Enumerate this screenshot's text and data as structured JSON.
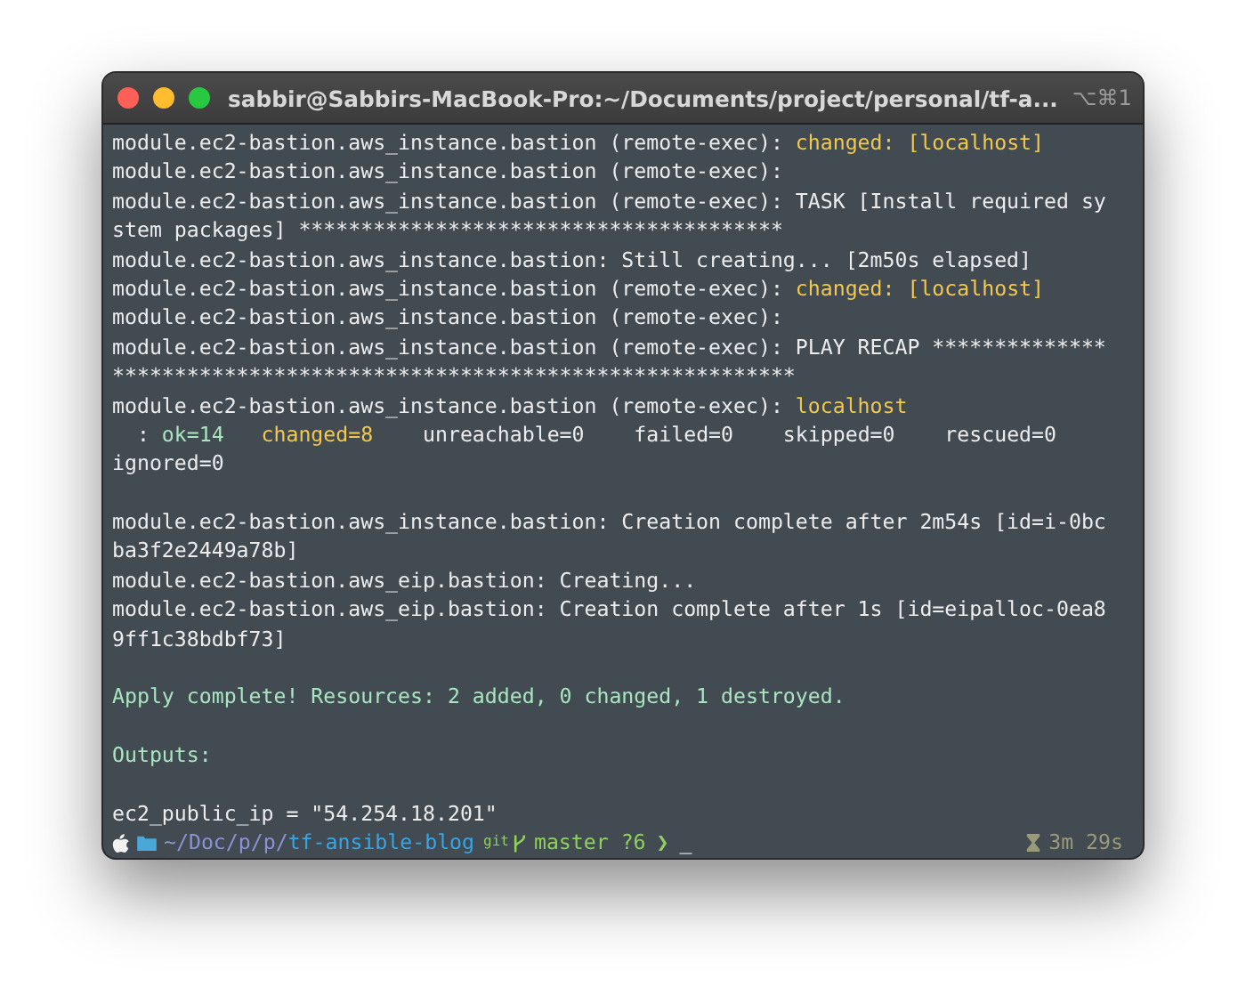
{
  "window": {
    "title": "sabbir@Sabbirs-MacBook-Pro:~/Documents/project/personal/tf-a...",
    "shortcut": "⌥⌘1"
  },
  "lines": [
    {
      "kind": "text",
      "segments": [
        {
          "text": "module.ec2-bastion.aws_instance.bastion (remote-exec): "
        },
        {
          "text": "changed: [localhost]",
          "color": "#f2c94c"
        }
      ]
    },
    {
      "kind": "text",
      "segments": [
        {
          "text": "module.ec2-bastion.aws_instance.bastion (remote-exec):"
        }
      ]
    },
    {
      "kind": "text",
      "segments": [
        {
          "text": "module.ec2-bastion.aws_instance.bastion (remote-exec): TASK [Install required sy"
        }
      ]
    },
    {
      "kind": "text",
      "segments": [
        {
          "text": "stem packages] ***************************************"
        }
      ]
    },
    {
      "kind": "text",
      "segments": [
        {
          "text": "module.ec2-bastion.aws_instance.bastion: Still creating... [2m50s elapsed]"
        }
      ]
    },
    {
      "kind": "text",
      "segments": [
        {
          "text": "module.ec2-bastion.aws_instance.bastion (remote-exec): "
        },
        {
          "text": "changed: [localhost]",
          "color": "#f2c94c"
        }
      ]
    },
    {
      "kind": "text",
      "segments": [
        {
          "text": "module.ec2-bastion.aws_instance.bastion (remote-exec):"
        }
      ]
    },
    {
      "kind": "text",
      "segments": [
        {
          "text": "module.ec2-bastion.aws_instance.bastion (remote-exec): PLAY RECAP **************"
        }
      ]
    },
    {
      "kind": "text",
      "segments": [
        {
          "text": "*******************************************************"
        }
      ]
    },
    {
      "kind": "text",
      "segments": [
        {
          "text": "module.ec2-bastion.aws_instance.bastion (remote-exec): "
        },
        {
          "text": "localhost",
          "color": "#f2c94c"
        }
      ]
    },
    {
      "kind": "text",
      "segments": [
        {
          "text": "  : "
        },
        {
          "text": "ok=14   ",
          "color": "#a9e5c0"
        },
        {
          "text": "changed=8",
          "color": "#f2c94c"
        },
        {
          "text": "    unreachable=0    failed=0    skipped=0    rescued=0"
        }
      ]
    },
    {
      "kind": "text",
      "segments": [
        {
          "text": "ignored=0"
        }
      ]
    },
    {
      "kind": "blank"
    },
    {
      "kind": "text",
      "segments": [
        {
          "text": "module.ec2-bastion.aws_instance.bastion: Creation complete after 2m54s [id=i-0bc"
        }
      ]
    },
    {
      "kind": "text",
      "segments": [
        {
          "text": "ba3f2e2449a78b]"
        }
      ]
    },
    {
      "kind": "text",
      "segments": [
        {
          "text": "module.ec2-bastion.aws_eip.bastion: Creating..."
        }
      ]
    },
    {
      "kind": "text",
      "segments": [
        {
          "text": "module.ec2-bastion.aws_eip.bastion: Creation complete after 1s [id=eipalloc-0ea8"
        }
      ]
    },
    {
      "kind": "text",
      "segments": [
        {
          "text": "9ff1c38bdbf73]"
        }
      ]
    },
    {
      "kind": "blank"
    },
    {
      "kind": "text",
      "segments": [
        {
          "text": "Apply complete! Resources: 2 added, 0 changed, 1 destroyed.",
          "color": "#a9e5c0"
        }
      ]
    },
    {
      "kind": "blank"
    },
    {
      "kind": "text",
      "segments": [
        {
          "text": "Outputs:",
          "color": "#a9e5c0"
        }
      ]
    },
    {
      "kind": "blank"
    },
    {
      "kind": "text",
      "segments": [
        {
          "text": "ec2_public_ip = \"54.254.18.201\""
        }
      ]
    }
  ],
  "prompt": {
    "path_parent": "~/Doc/p/p/",
    "path_dir": "tf-ansible-blog",
    "vcs": "git",
    "branch": "master ?6",
    "chevron": "❯",
    "cursor": "_",
    "duration": "3m 29s"
  }
}
